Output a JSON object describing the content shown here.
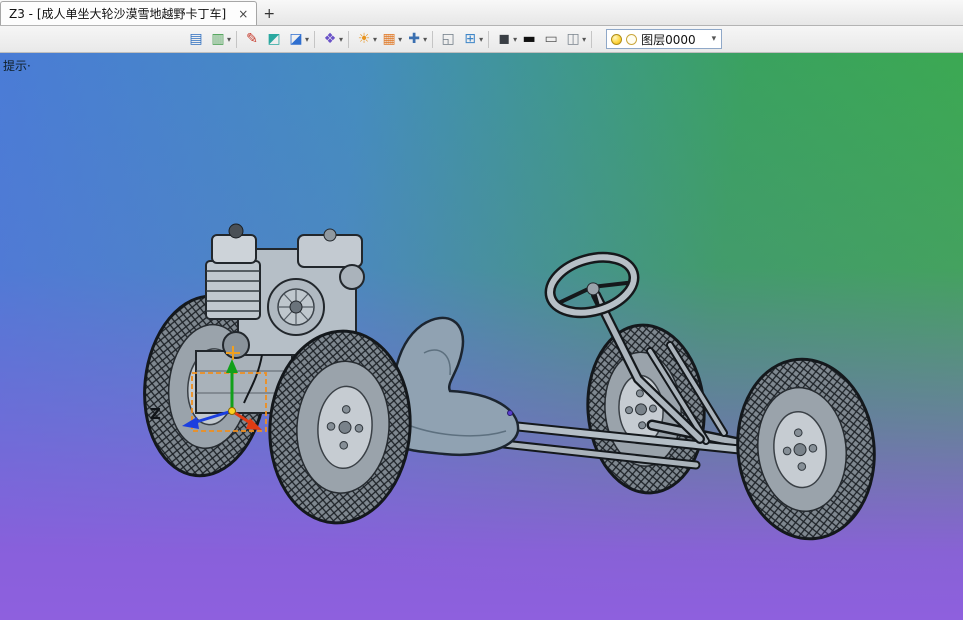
{
  "window": {
    "tab_title": "Z3 - [成人单坐大轮沙漠雪地越野卡丁车]",
    "tab_close": "×",
    "new_tab": "+"
  },
  "toolbar": {
    "caret": "▾",
    "icons": [
      {
        "name": "open-file",
        "glyph": "▤"
      },
      {
        "name": "print",
        "glyph": "▥"
      },
      {
        "name": "sketch-pen",
        "glyph": "✎"
      },
      {
        "name": "solid-extrude",
        "glyph": "◩"
      },
      {
        "name": "solid-box",
        "glyph": "◪"
      },
      {
        "name": "assembly",
        "glyph": "❖"
      },
      {
        "name": "color-wheel",
        "glyph": "☀"
      },
      {
        "name": "texture",
        "glyph": "▦"
      },
      {
        "name": "move",
        "glyph": "✚"
      },
      {
        "name": "viewport",
        "glyph": "◱"
      },
      {
        "name": "grid",
        "glyph": "⊞"
      },
      {
        "name": "display-shaded",
        "glyph": "◼"
      },
      {
        "name": "line-width",
        "glyph": "▬"
      },
      {
        "name": "background",
        "glyph": "▭"
      },
      {
        "name": "section-view",
        "glyph": "◫"
      }
    ],
    "layer_combo": {
      "value": "图层0000"
    }
  },
  "prompt": "提示·",
  "viewport": {
    "triad_label": "Z"
  },
  "colors": {
    "bg_top_left": "#4a7cd6",
    "bg_top_right": "#3cab4e",
    "bg_bottom": "#8c5edc",
    "model_gray": "#b6bfc7",
    "selection_orange": "#ef8f1f",
    "axis_green": "#12a01b",
    "axis_blue": "#1b3fe0",
    "axis_red": "#e03c14"
  }
}
